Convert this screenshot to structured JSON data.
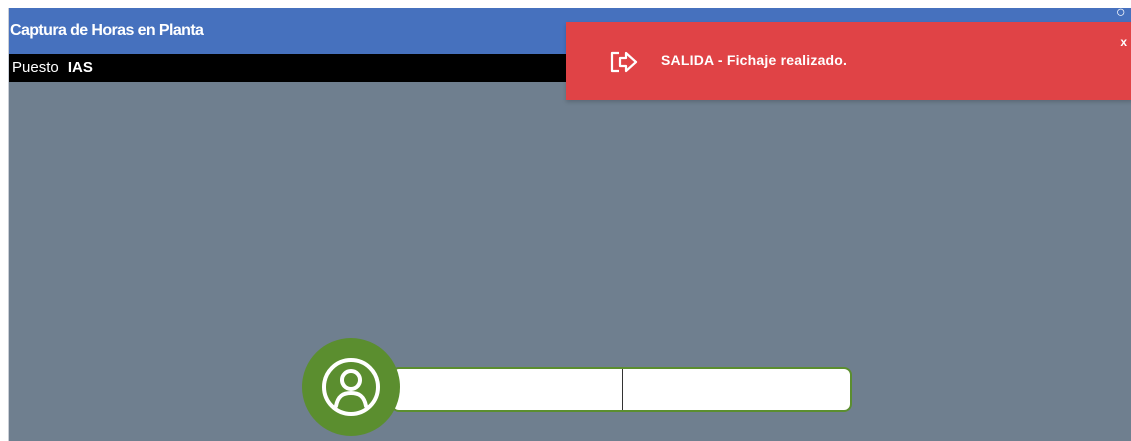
{
  "window": {
    "title": "Captura de Horas en Planta",
    "close_mark": "○"
  },
  "station": {
    "label": "Puesto",
    "value": "IAS"
  },
  "toast": {
    "icon": "logout-icon",
    "message": "SALIDA - Fichaje realizado.",
    "close_label": "x",
    "color": "#e04346"
  },
  "login": {
    "avatar_icon": "user-icon",
    "first_field": {
      "value": "",
      "placeholder": ""
    },
    "second_field": {
      "value": "",
      "placeholder": ""
    }
  },
  "colors": {
    "title_bar": "#4671be",
    "station_bar": "#000000",
    "content_background": "#6f7f8f",
    "avatar": "#5b8e2f",
    "field_border": "#5b8e2f",
    "toast": "#e04346"
  }
}
